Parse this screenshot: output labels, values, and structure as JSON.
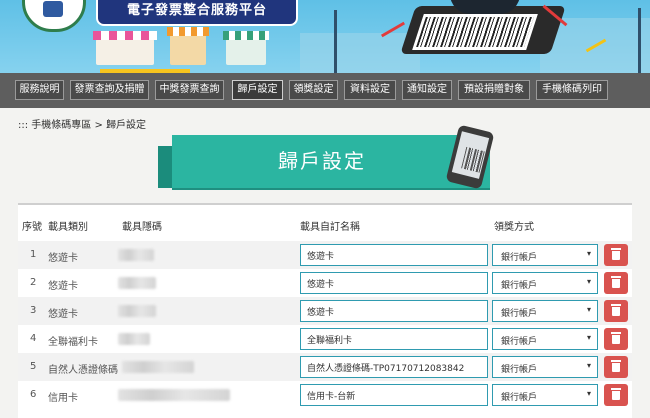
{
  "header": {
    "title": "電子發票整合服務平台"
  },
  "nav": {
    "items": [
      {
        "label": "服務說明",
        "active": false
      },
      {
        "label": "發票查詢及捐贈",
        "active": false
      },
      {
        "label": "中獎發票查詢",
        "active": false
      },
      {
        "label": "歸戶設定",
        "active": true
      },
      {
        "label": "領獎設定",
        "active": false
      },
      {
        "label": "資料設定",
        "active": false
      },
      {
        "label": "通知設定",
        "active": false
      },
      {
        "label": "預設捐贈對象",
        "active": false
      },
      {
        "label": "手機條碼列印",
        "active": false
      }
    ]
  },
  "breadcrumb": {
    "prefix": ":::",
    "parent": "手機條碼專區",
    "separator": ">",
    "current": "歸戶設定"
  },
  "page": {
    "heading": "歸戶設定"
  },
  "table": {
    "headers": {
      "index": "序號",
      "type": "載具類別",
      "code": "載具隱碼",
      "custom_name": "載具自訂名稱",
      "method": "領獎方式"
    },
    "rows": [
      {
        "index": "1",
        "type": "悠遊卡",
        "custom_name": "悠遊卡",
        "method": "銀行帳戶"
      },
      {
        "index": "2",
        "type": "悠遊卡",
        "custom_name": "悠遊卡",
        "method": "銀行帳戶"
      },
      {
        "index": "3",
        "type": "悠遊卡",
        "custom_name": "悠遊卡",
        "method": "銀行帳戶"
      },
      {
        "index": "4",
        "type": "全聯福利卡",
        "custom_name": "全聯福利卡",
        "method": "銀行帳戶"
      },
      {
        "index": "5",
        "type": "自然人憑證條碼",
        "custom_name": "自然人憑證條碼-TP07170712083842",
        "method": "銀行帳戶"
      },
      {
        "index": "6",
        "type": "信用卡",
        "custom_name": "信用卡-台新",
        "method": "銀行帳戶"
      }
    ]
  },
  "colors": {
    "accent_teal": "#2bb5a1",
    "nav_bg": "#5e5e5e",
    "delete_red": "#d9534f",
    "header_navy": "#20357d"
  },
  "icons": {
    "delete": "trash-icon",
    "select": "chevron-down-icon"
  }
}
